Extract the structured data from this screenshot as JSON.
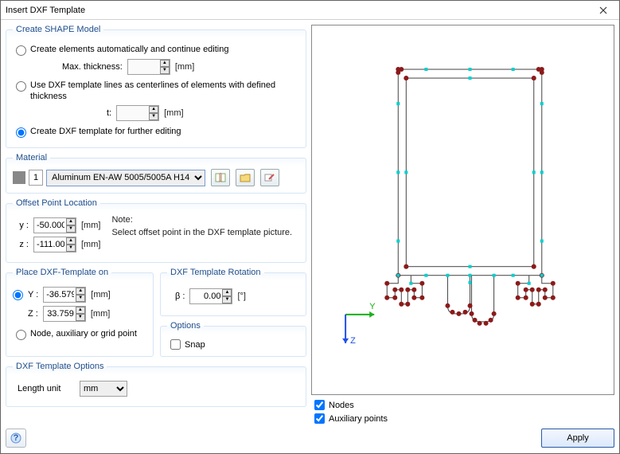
{
  "window": {
    "title": "Insert DXF Template"
  },
  "shape_model": {
    "legend": "Create SHAPE Model",
    "opt1": "Create elements automatically and continue editing",
    "max_thick_label": "Max. thickness:",
    "max_thick_value": "",
    "opt2": "Use DXF template lines as centerlines of elements with defined thickness",
    "t_label": "t:",
    "t_value": "",
    "opt3": "Create DXF template for further editing",
    "unit": "[mm]",
    "selected": "opt3"
  },
  "material": {
    "legend": "Material",
    "index": "1",
    "name": "Aluminum EN-AW 5005/5005A H14"
  },
  "offset": {
    "legend": "Offset Point Location",
    "y_label": "y :",
    "y_value": "-50.000",
    "z_label": "z :",
    "z_value": "-111.000",
    "unit": "[mm]",
    "note_head": "Note:",
    "note_body": "Select offset point in the DXF template picture."
  },
  "place": {
    "legend": "Place DXF-Template on",
    "mode_yz_label_y": "Y :",
    "mode_yz_label_z": "Z :",
    "y_value": "-36.579",
    "z_value": "33.759",
    "unit": "[mm]",
    "mode_node": "Node, auxiliary or grid point",
    "selected": "yz"
  },
  "rotation": {
    "legend": "DXF Template Rotation",
    "beta_label": "β :",
    "beta_value": "0.00",
    "unit": "[°]"
  },
  "options": {
    "legend": "Options",
    "snap_label": "Snap",
    "snap_checked": false
  },
  "dxf_options": {
    "legend": "DXF Template Options",
    "length_unit_label": "Length unit",
    "length_unit_value": "mm"
  },
  "preview_checks": {
    "nodes_label": "Nodes",
    "nodes_checked": true,
    "aux_label": "Auxiliary points",
    "aux_checked": true
  },
  "buttons": {
    "apply": "Apply"
  },
  "axes": {
    "y": "Y",
    "z": "Z"
  }
}
